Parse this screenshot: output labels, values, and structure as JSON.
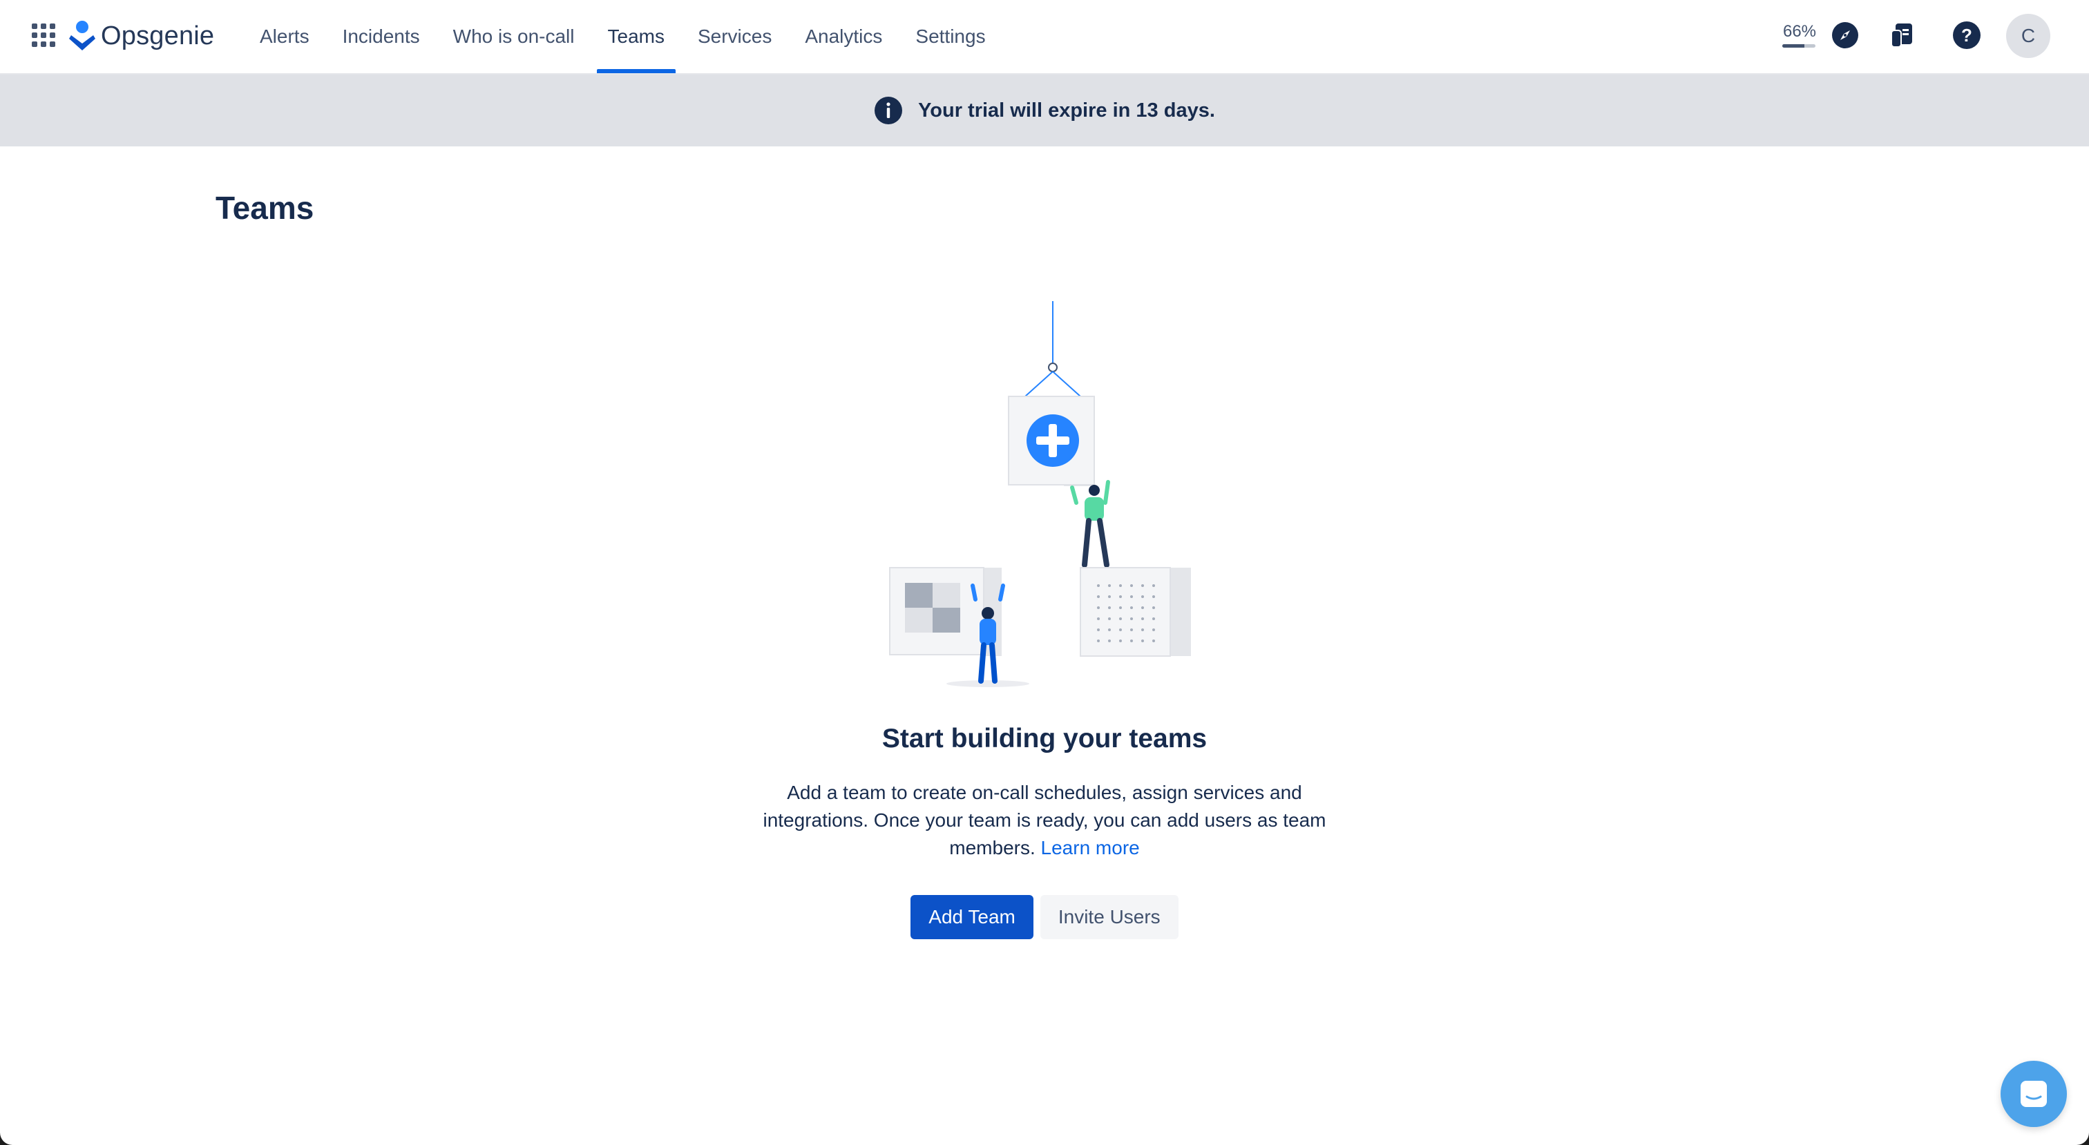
{
  "app": {
    "name": "Opsgenie"
  },
  "nav": {
    "items": [
      {
        "label": "Alerts",
        "active": false
      },
      {
        "label": "Incidents",
        "active": false
      },
      {
        "label": "Who is on-call",
        "active": false
      },
      {
        "label": "Teams",
        "active": true
      },
      {
        "label": "Services",
        "active": false
      },
      {
        "label": "Analytics",
        "active": false
      },
      {
        "label": "Settings",
        "active": false
      }
    ]
  },
  "tools": {
    "zoom_label": "66%",
    "zoom_level": 0.66,
    "icons": [
      "compass-icon",
      "release-notes-icon",
      "help-icon"
    ],
    "avatar_initial": "C"
  },
  "banner": {
    "text": "Your trial will expire in 13 days.",
    "icon": "info-icon"
  },
  "page": {
    "title": "Teams"
  },
  "empty_state": {
    "title": "Start building your teams",
    "description": "Add a team to create on-call schedules, assign services and integrations. Once your team is ready, you can add users as team members.",
    "learn_more": "Learn more",
    "primary_button": "Add Team",
    "secondary_button": "Invite Users"
  },
  "colors": {
    "primary": "#0c52c8",
    "nav_active_underline": "#0c66e4",
    "banner_bg": "#dfe1e6",
    "chat": "#4da3ea"
  }
}
